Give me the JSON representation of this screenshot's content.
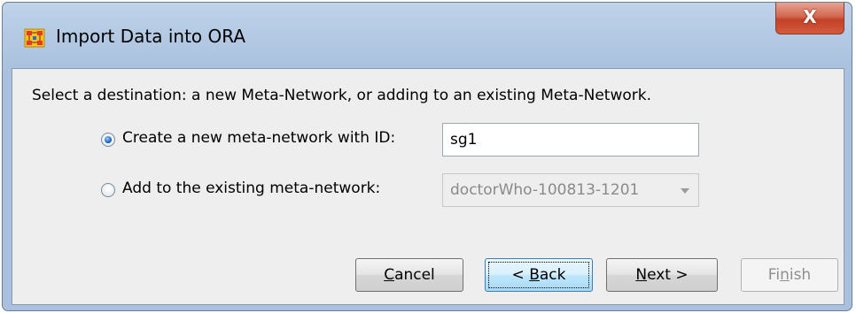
{
  "window": {
    "title": "Import Data into ORA",
    "close_label": "X"
  },
  "instruction": "Select a destination: a new Meta-Network, or adding to an existing Meta-Network.",
  "options": {
    "create_new": {
      "label": "Create a new meta-network with ID:",
      "selected": true,
      "id_value": "sg1"
    },
    "add_existing": {
      "label": "Add to the existing meta-network:",
      "selected": false,
      "selected_network": "doctorWho-100813-1201"
    }
  },
  "buttons": {
    "cancel": {
      "pre": "",
      "mnemonic": "C",
      "post": "ancel"
    },
    "back": {
      "pre": "< ",
      "mnemonic": "B",
      "post": "ack"
    },
    "next": {
      "pre": "",
      "mnemonic": "N",
      "post": "ext >"
    },
    "finish": {
      "pre": "Fi",
      "mnemonic": "n",
      "post": "ish"
    }
  },
  "colors": {
    "title_bar": "#b3c9e3",
    "close_button": "#c34128",
    "client_background": "#eeeeee",
    "focus_button": "#bee6fd"
  },
  "icons": {
    "app": "ora-grid-icon",
    "close": "close-icon",
    "dropdown": "chevron-down-icon"
  }
}
